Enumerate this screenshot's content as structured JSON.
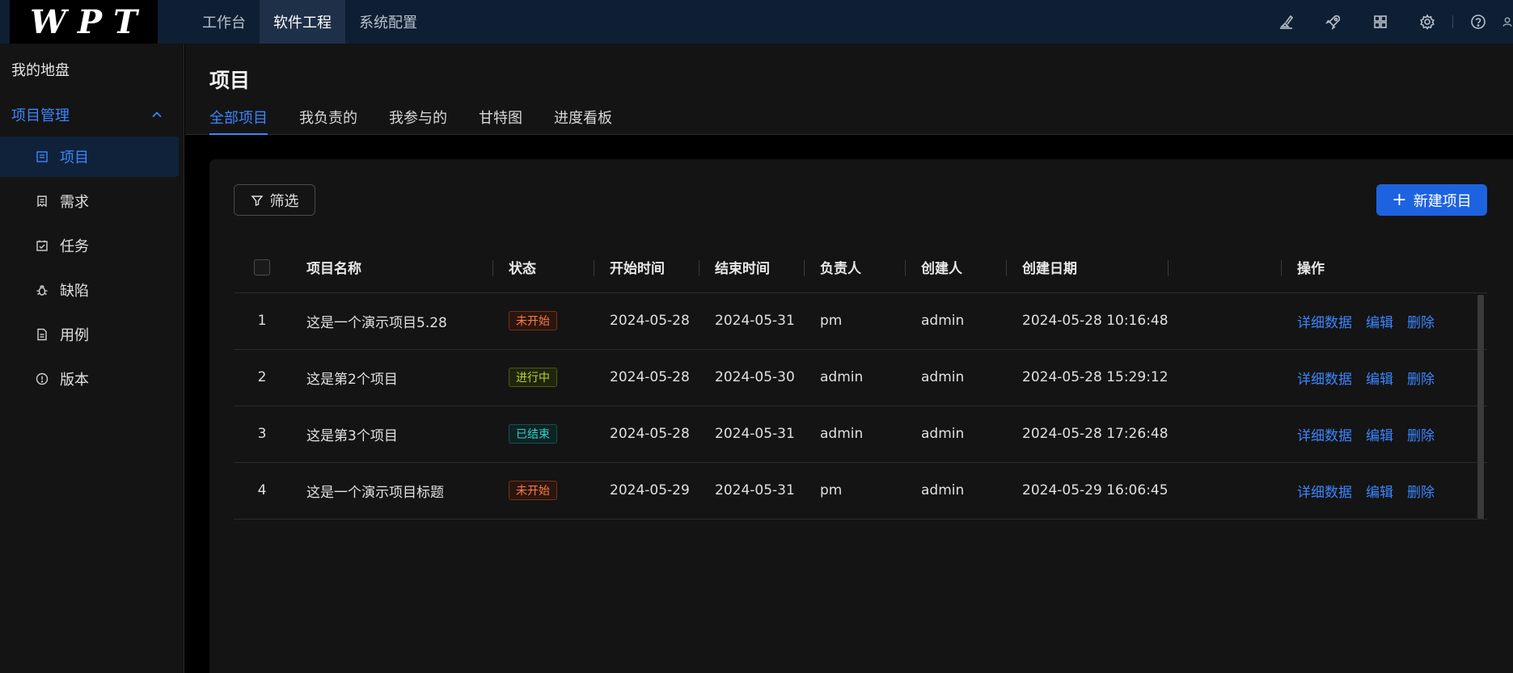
{
  "logo": "WPT",
  "topnav": [
    "工作台",
    "软件工程",
    "系统配置"
  ],
  "sidebar": {
    "top": "我的地盘",
    "group": "项目管理",
    "items": [
      {
        "label": "项目",
        "icon": "list-icon"
      },
      {
        "label": "需求",
        "icon": "document-icon"
      },
      {
        "label": "任务",
        "icon": "task-icon"
      },
      {
        "label": "缺陷",
        "icon": "bug-icon"
      },
      {
        "label": "用例",
        "icon": "file-icon"
      },
      {
        "label": "版本",
        "icon": "info-icon"
      }
    ]
  },
  "page": {
    "title": "项目",
    "tabs": [
      "全部项目",
      "我负责的",
      "我参与的",
      "甘特图",
      "进度看板"
    ]
  },
  "toolbar": {
    "filter_label": "筛选",
    "new_label": "新建项目"
  },
  "table": {
    "headers": {
      "name": "项目名称",
      "status": "状态",
      "start": "开始时间",
      "end": "结束时间",
      "owner": "负责人",
      "creator": "创建人",
      "created": "创建日期",
      "actions": "操作"
    },
    "actions": {
      "detail": "详细数据",
      "edit": "编辑",
      "delete": "删除"
    },
    "rows": [
      {
        "idx": "1",
        "name": "这是一个演示项目5.28",
        "status": "未开始",
        "start": "2024-05-28",
        "end": "2024-05-31",
        "owner": "pm",
        "creator": "admin",
        "created": "2024-05-28 10:16:48"
      },
      {
        "idx": "2",
        "name": "这是第2个项目",
        "status": "进行中",
        "start": "2024-05-28",
        "end": "2024-05-30",
        "owner": "admin",
        "creator": "admin",
        "created": "2024-05-28 15:29:12"
      },
      {
        "idx": "3",
        "name": "这是第3个项目",
        "status": "已结束",
        "start": "2024-05-28",
        "end": "2024-05-31",
        "owner": "admin",
        "creator": "admin",
        "created": "2024-05-28 17:26:48"
      },
      {
        "idx": "4",
        "name": "这是一个演示项目标题",
        "status": "未开始",
        "start": "2024-05-29",
        "end": "2024-05-31",
        "owner": "pm",
        "creator": "admin",
        "created": "2024-05-29 16:06:45"
      }
    ]
  },
  "colors": {
    "accent": "#3a86ff",
    "primary_button": "#1d63e0",
    "status_not_started": "#ff7a45",
    "status_in_progress": "#b8d432",
    "status_done": "#36cfc9"
  }
}
